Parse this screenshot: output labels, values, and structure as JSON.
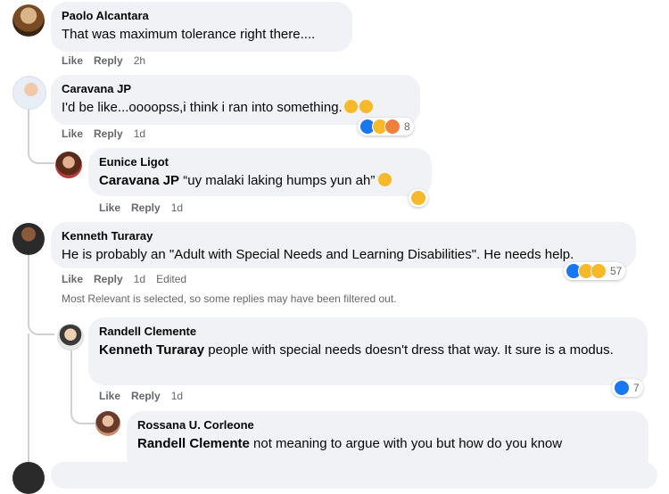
{
  "comments": [
    {
      "author": "Paolo Alcantara",
      "text": "That was maximum tolerance right there....",
      "like": "Like",
      "reply": "Reply",
      "time": "2h"
    },
    {
      "author": "Caravana JP",
      "text": "I'd be like...oooopss,i think i ran into something.",
      "like": "Like",
      "reply": "Reply",
      "time": "1d",
      "reaction_count": "8"
    },
    {
      "author": "Eunice Ligot",
      "mention": "Caravana JP",
      "text": " “uy malaki laking humps yun ah”",
      "like": "Like",
      "reply": "Reply",
      "time": "1d"
    },
    {
      "author": "Kenneth Turaray",
      "text": "He is probably an \"Adult with Special Needs and Learning Disabilities\". He needs help.",
      "like": "Like",
      "reply": "Reply",
      "time": "1d",
      "edited": "Edited",
      "reaction_count": "57"
    },
    {
      "author": "Randell Clemente",
      "mention": "Kenneth Turaray",
      "text": " people with special needs doesn't dress that way. It sure is a modus.",
      "like": "Like",
      "reply": "Reply",
      "time": "1d",
      "reaction_count": "7"
    },
    {
      "author": "Rossana U. Corleone",
      "mention": "Randell Clemente",
      "text": " not meaning to argue with you but how do you know"
    }
  ],
  "filter_note": "Most Relevant is selected, so some replies may have been filtered out.",
  "colors": {
    "bubble": "#f0f2f5",
    "meta": "#65676b",
    "like_blue": "#1877f2",
    "haha_yellow": "#f7b928"
  }
}
